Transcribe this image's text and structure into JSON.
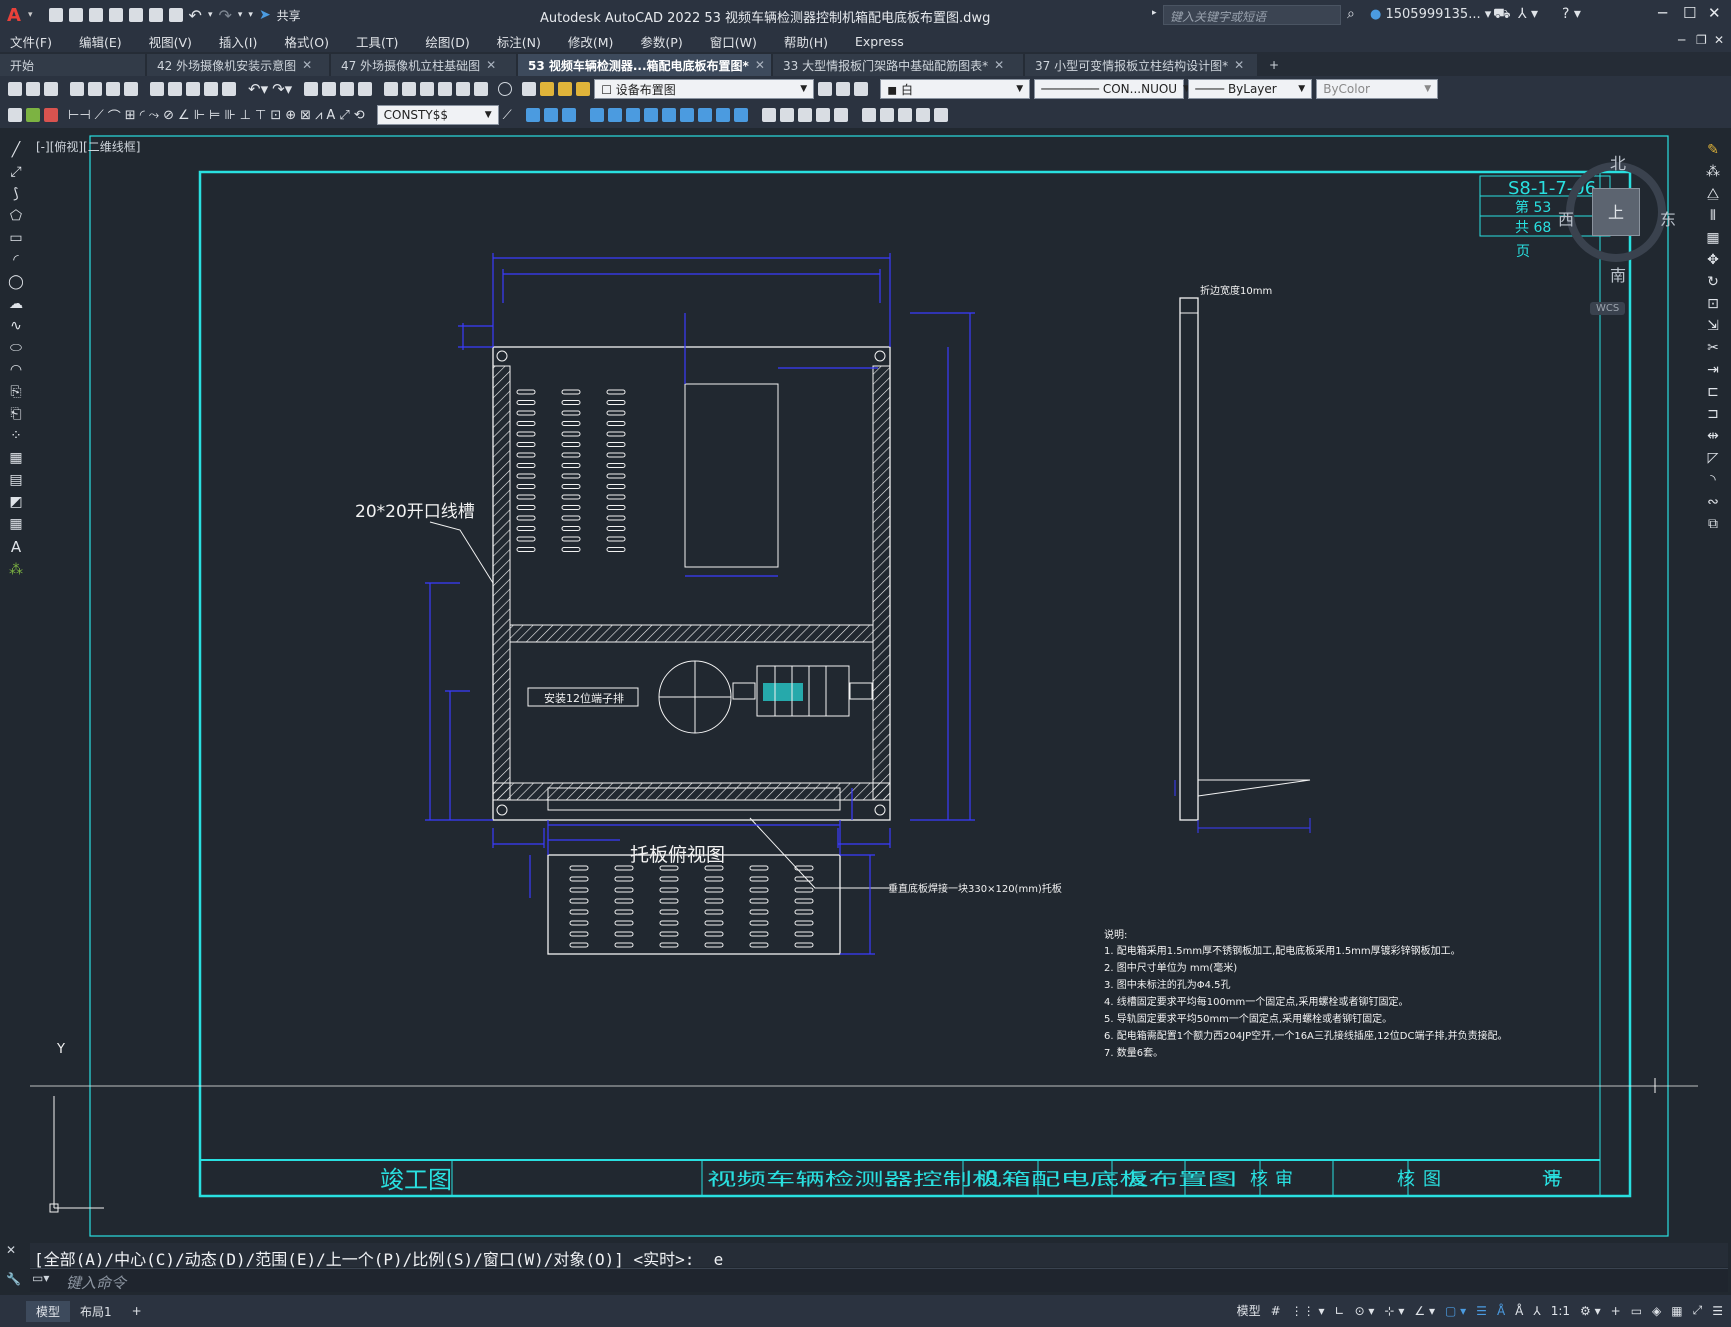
{
  "app": {
    "title": "Autodesk AutoCAD 2022    53  视频车辆检测器控制机箱配电底板布置图.dwg",
    "search_placeholder": "键入关键字或短语",
    "user": "1505999135...",
    "share": "共享"
  },
  "menu": [
    "文件(F)",
    "编辑(E)",
    "视图(V)",
    "插入(I)",
    "格式(O)",
    "工具(T)",
    "绘图(D)",
    "标注(N)",
    "修改(M)",
    "参数(P)",
    "窗口(W)",
    "帮助(H)",
    "Express"
  ],
  "tabs": [
    {
      "label": "开始",
      "active": false
    },
    {
      "label": "42  外场摄像机安装示意图",
      "active": false
    },
    {
      "label": "47  外场摄像机立柱基础图",
      "active": false
    },
    {
      "label": "53  视频车辆检测器...箱配电底板布置图*",
      "active": true
    },
    {
      "label": "33  大型情报板门架路中基础配筋图表*",
      "active": false
    },
    {
      "label": "37  小型可变情报板立柱结构设计图*",
      "active": false
    }
  ],
  "ribbon": {
    "layer": "设备布置图",
    "color": "白",
    "linetype": "CON...NUOU",
    "lineweight": "ByLayer",
    "plotstyle": "ByColor",
    "textstyle": "CONSTY$$"
  },
  "viewport": {
    "label": "[-][俯视][二维线框]"
  },
  "viewcube": {
    "north": "北",
    "south": "南",
    "east": "东",
    "west": "西",
    "top": "上",
    "wcs": "WCS"
  },
  "drawing": {
    "sheet_code": "S8-1-7-06",
    "sheet_no": "第 53",
    "sheet_total": "共 68",
    "sheet_page": "页",
    "label_trough": "20*20开口线槽",
    "label_terminal": "安装12位端子排",
    "label_top_view": "托板俯视图",
    "label_bracket": "垂直底板焊接一块330×120(mm)托板",
    "label_bend": "折边宽度10mm",
    "notes_title": "说明:",
    "notes": [
      "1.    配电箱采用1.5mm厚不锈钢板加工,配电底板采用1.5mm厚镀彩锌钢板加工。",
      "2.    图中尺寸单位为 mm(毫米)",
      "3.    图中未标注的孔为Φ4.5孔",
      "4.    线槽固定要求平均每100mm一个固定点,采用螺栓或者铆钉固定。",
      "5.    导轨固定要求平均50mm一个固定点,采用螺栓或者铆钉固定。",
      "6.    配电箱需配置1个额力西204JP空开,一个16A三孔接线插座,12位DC端子排,并负责接配。",
      "7.    数量6套。"
    ],
    "title_block": {
      "stamp": "竣工图",
      "name": "视频车辆检测器控制机箱配电底板布置图",
      "design": "设计",
      "review": "复核",
      "audit": "审核",
      "number": "图号"
    }
  },
  "command": {
    "history": "[全部(A)/中心(C)/动态(D)/范围(E)/上一个(P)/比例(S)/窗口(W)/对象(O)] <实时>: _e",
    "placeholder": "键入命令"
  },
  "status": {
    "tabs": [
      "模型",
      "布局1"
    ],
    "model": "模型",
    "scale": "1:1"
  },
  "colors": {
    "cyan": "#29e0e0",
    "blue": "#1f1fff",
    "white": "#f2f2f2",
    "bg": "#212830"
  }
}
